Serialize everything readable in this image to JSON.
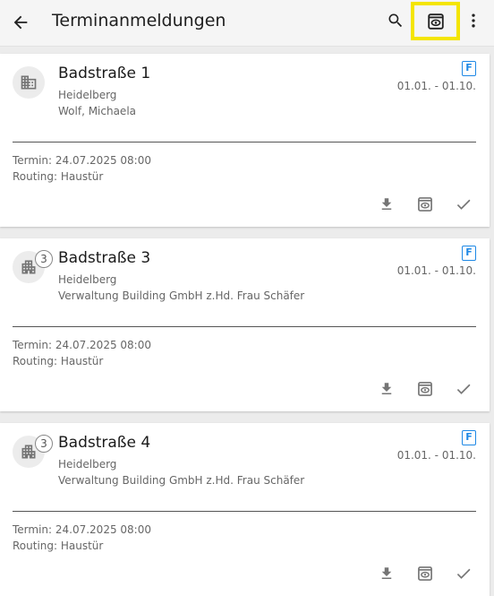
{
  "header": {
    "title": "Terminanmeldungen",
    "icons": [
      "arrow-back-icon",
      "search-icon",
      "view-icon",
      "more-vert-icon"
    ]
  },
  "cards": [
    {
      "title": "Badstraße 1",
      "city": "Heidelberg",
      "owner": "Wolf, Michaela",
      "badge": "F",
      "period": "01.01. - 01.10.",
      "count": null,
      "termin": "Termin: 24.07.2025 08:00",
      "routing": "Routing: Haustür",
      "icon": "building-icon"
    },
    {
      "title": "Badstraße 3",
      "city": "Heidelberg",
      "owner": "Verwaltung Building GmbH z.Hd. Frau Schäfer",
      "badge": "F",
      "period": "01.01. - 01.10.",
      "count": "3",
      "termin": "Termin: 24.07.2025 08:00",
      "routing": "Routing: Haustür",
      "icon": "apartment-icon"
    },
    {
      "title": "Badstraße 4",
      "city": "Heidelberg",
      "owner": "Verwaltung Building GmbH z.Hd. Frau Schäfer",
      "badge": "F",
      "period": "01.01. - 01.10.",
      "count": "3",
      "termin": "Termin: 24.07.2025 08:00",
      "routing": "Routing: Haustür",
      "icon": "apartment-icon"
    }
  ],
  "colors": {
    "accent_blue": "#1e88e5",
    "highlight_yellow": "#f4e500",
    "icon_gray": "#757575"
  }
}
